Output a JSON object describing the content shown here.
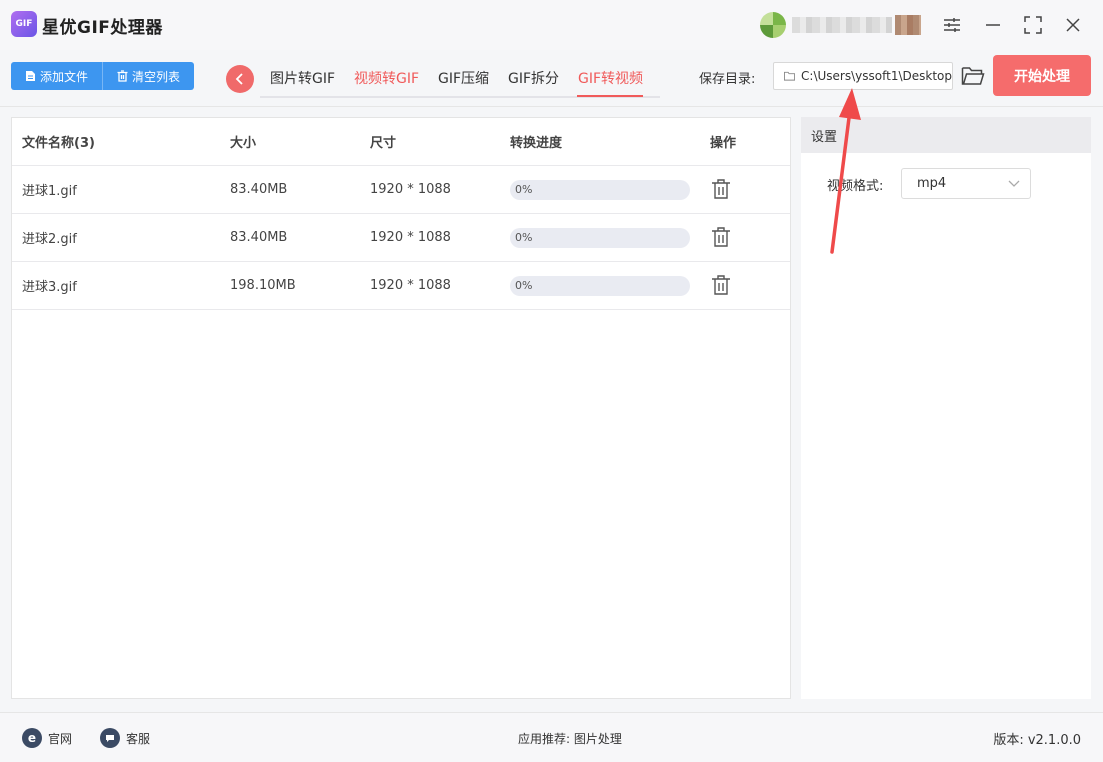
{
  "app": {
    "logo_text": "GIF",
    "title": "星优GIF处理器"
  },
  "toolbar": {
    "add_file": "添加文件",
    "clear_list": "清空列表",
    "tabs": [
      {
        "label": "图片转GIF",
        "active": false
      },
      {
        "label": "视频转GIF",
        "active": false,
        "highlight": true
      },
      {
        "label": "GIF压缩",
        "active": false
      },
      {
        "label": "GIF拆分",
        "active": false
      },
      {
        "label": "GIF转视频",
        "active": true
      }
    ],
    "save_dir_label": "保存目录:",
    "save_dir_value": "C:\\Users\\yssoft1\\Desktop",
    "start_button": "开始处理"
  },
  "table": {
    "headers": {
      "name": "文件名称(3)",
      "size": "大小",
      "dimensions": "尺寸",
      "progress": "转换进度",
      "action": "操作"
    },
    "rows": [
      {
        "name": "进球1.gif",
        "size": "83.40MB",
        "dimensions": "1920 * 1088",
        "progress_label": "0%",
        "progress": 0
      },
      {
        "name": "进球2.gif",
        "size": "83.40MB",
        "dimensions": "1920 * 1088",
        "progress_label": "0%",
        "progress": 0
      },
      {
        "name": "进球3.gif",
        "size": "198.10MB",
        "dimensions": "1920 * 1088",
        "progress_label": "0%",
        "progress": 0
      }
    ]
  },
  "settings": {
    "header": "设置",
    "format_label": "视频格式:",
    "format_value": "mp4"
  },
  "footer": {
    "website": "官网",
    "support": "客服",
    "recommend": "应用推荐: 图片处理",
    "version": "版本: v2.1.0.0"
  },
  "colors": {
    "accent_red": "#f56c6c",
    "accent_blue": "#3d96f0",
    "arrow": "#ef4a4a"
  }
}
